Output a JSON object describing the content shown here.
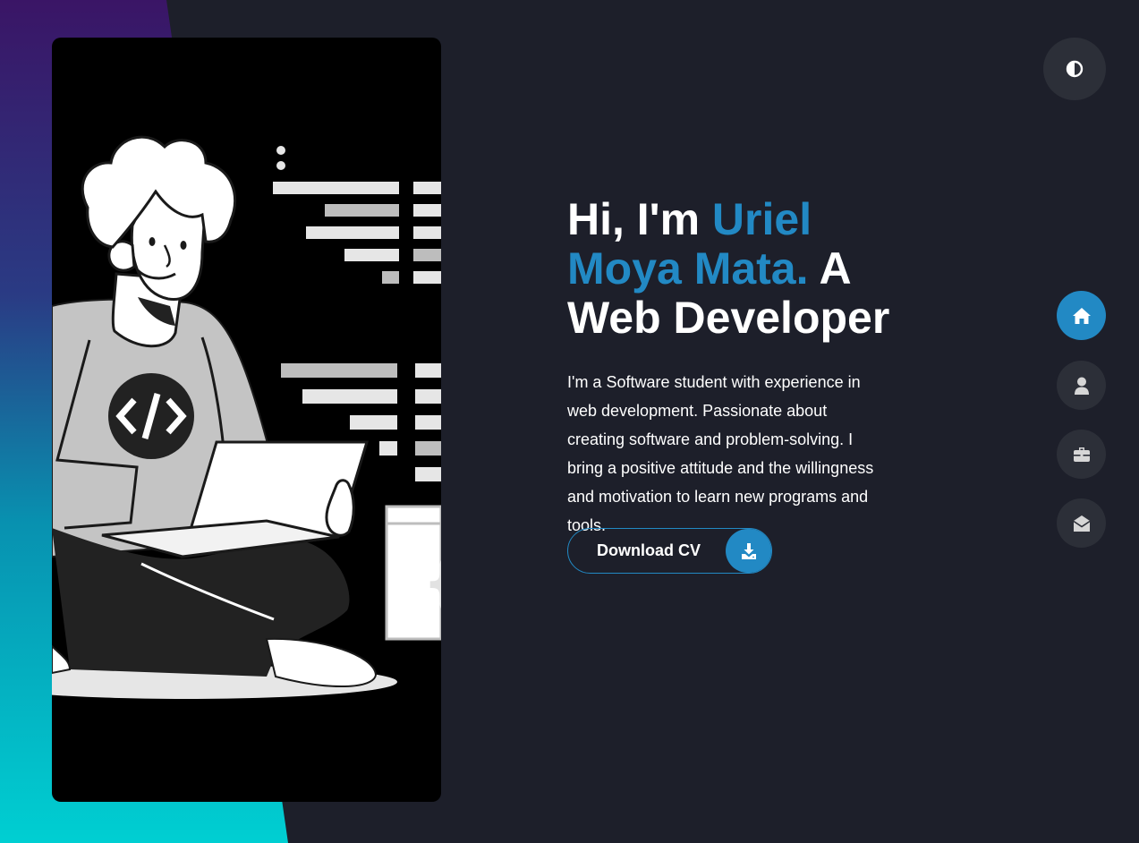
{
  "hero": {
    "greeting": "Hi, I'm ",
    "name": "Uriel Moya Mata.",
    "role": " A Web Developer",
    "description": "I'm a Software student with experience in web development. Passionate about creating software and problem-solving. I bring a positive attitude and the willingness and motivation to learn new programs and tools.",
    "download_label": "Download CV"
  },
  "nav": {
    "items": [
      {
        "icon": "home-icon",
        "active": true
      },
      {
        "icon": "user-icon",
        "active": false
      },
      {
        "icon": "briefcase-icon",
        "active": false
      },
      {
        "icon": "envelope-open-icon",
        "active": false
      }
    ]
  },
  "theme_toggle": {
    "icon": "contrast-icon"
  },
  "colors": {
    "background": "#1d1f2a",
    "accent": "#2289c4",
    "button_bg": "#2c2f38",
    "text": "#ffffff",
    "gradient_top": "#3a1566",
    "gradient_bottom": "#00cfd2"
  }
}
